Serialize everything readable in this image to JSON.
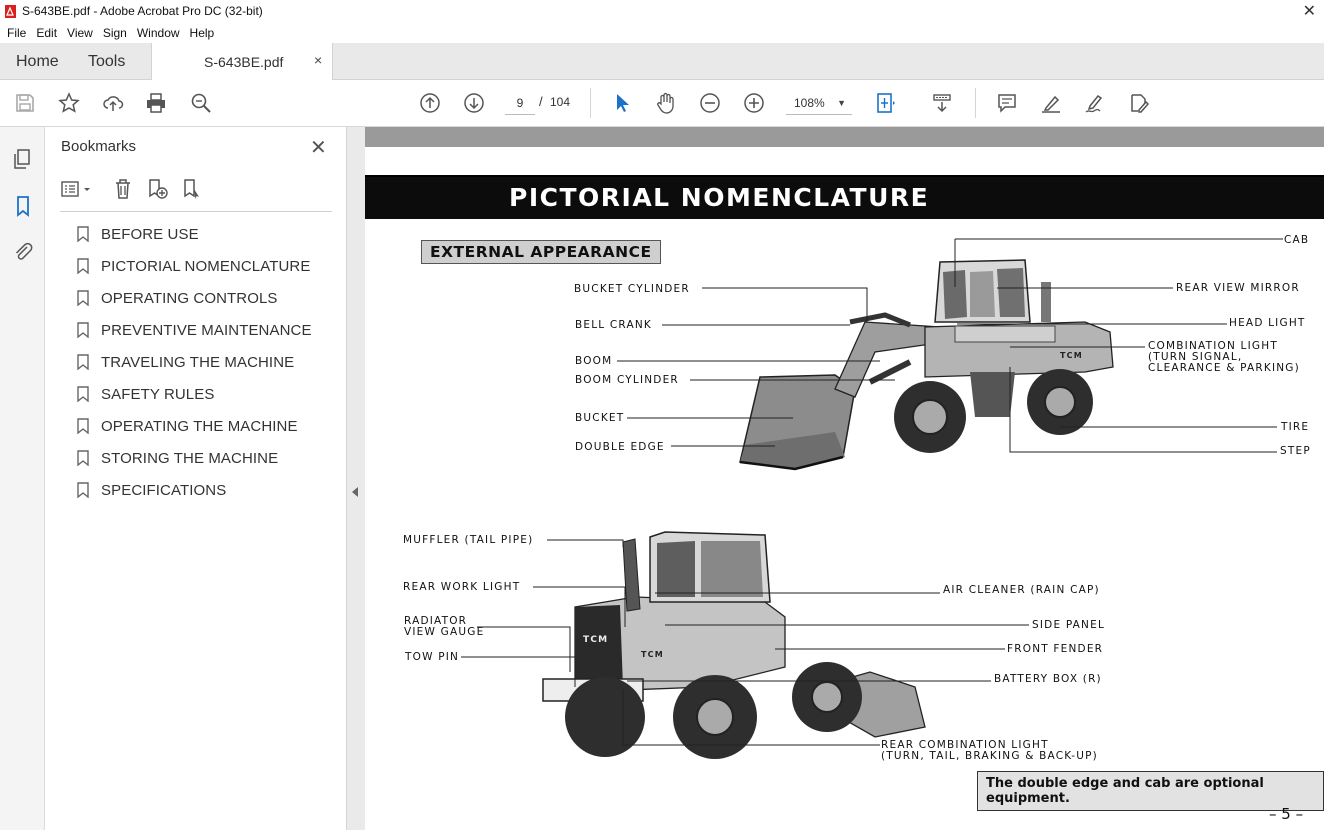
{
  "window": {
    "title": "S-643BE.pdf - Adobe Acrobat Pro DC (32-bit)",
    "close_glyph": "✕"
  },
  "menu": [
    "File",
    "Edit",
    "View",
    "Sign",
    "Window",
    "Help"
  ],
  "tabs": {
    "home": "Home",
    "tools": "Tools",
    "document": "S-643BE.pdf",
    "close_glyph": "×"
  },
  "toolbar": {
    "current_page": "9",
    "page_separator": "/",
    "total_pages": "104",
    "zoom": "108%",
    "icons": [
      "save-icon",
      "star-icon",
      "upload-icon",
      "print-icon",
      "search-icon",
      "page-up-icon",
      "page-down-icon",
      "select-arrow-icon",
      "hand-icon",
      "zoom-out-icon",
      "zoom-in-icon",
      "fit-page-icon",
      "scroll-mode-icon",
      "comment-icon",
      "highlight-icon",
      "sign-icon",
      "edit-pdf-icon"
    ]
  },
  "left_rail": {
    "icons": [
      "pages-icon",
      "bookmarks-icon",
      "attachments-icon"
    ]
  },
  "bookmarks": {
    "title": "Bookmarks",
    "close_glyph": "✕",
    "items": [
      "BEFORE USE",
      "PICTORIAL NOMENCLATURE",
      "OPERATING CONTROLS",
      "PREVENTIVE MAINTENANCE",
      "TRAVELING THE MACHINE",
      "SAFETY RULES",
      "OPERATING THE MACHINE",
      "STORING THE MACHINE",
      "SPECIFICATIONS"
    ]
  },
  "document": {
    "banner": "PICTORIAL NOMENCLATURE",
    "subheading": "EXTERNAL APPEARANCE",
    "front_labels_left": {
      "bucket_cylinder": "BUCKET CYLINDER",
      "bell_crank": "BELL CRANK",
      "boom": "BOOM",
      "boom_cylinder": "BOOM CYLINDER",
      "bucket": "BUCKET",
      "double_edge": "DOUBLE EDGE"
    },
    "front_labels_right": {
      "cab": "CAB",
      "rear_view_mirror": "REAR VIEW MIRROR",
      "head_light": "HEAD LIGHT",
      "combination_light_1": "COMBINATION LIGHT",
      "combination_light_2": "(TURN SIGNAL,",
      "combination_light_3": "CLEARANCE & PARKING)",
      "tire": "TIRE",
      "step": "STEP"
    },
    "rear_labels_left": {
      "muffler": "MUFFLER (TAIL PIPE)",
      "rear_work_light": "REAR WORK LIGHT",
      "radiator_1": "RADIATOR",
      "radiator_2": "VIEW GAUGE",
      "tow_pin": "TOW PIN"
    },
    "rear_labels_right": {
      "air_cleaner": "AIR CLEANER (RAIN CAP)",
      "side_panel": "SIDE PANEL",
      "front_fender": "FRONT FENDER",
      "battery_box": "BATTERY BOX (R)",
      "rear_combination_1": "REAR COMBINATION LIGHT",
      "rear_combination_2": "(TURN, TAIL, BRAKING & BACK-UP)"
    },
    "brand_front": "TCM",
    "brand_rear_1": "TCM",
    "brand_rear_2": "TCM",
    "note": "The double edge and cab are optional equipment.",
    "page_number": "– 5 –"
  }
}
